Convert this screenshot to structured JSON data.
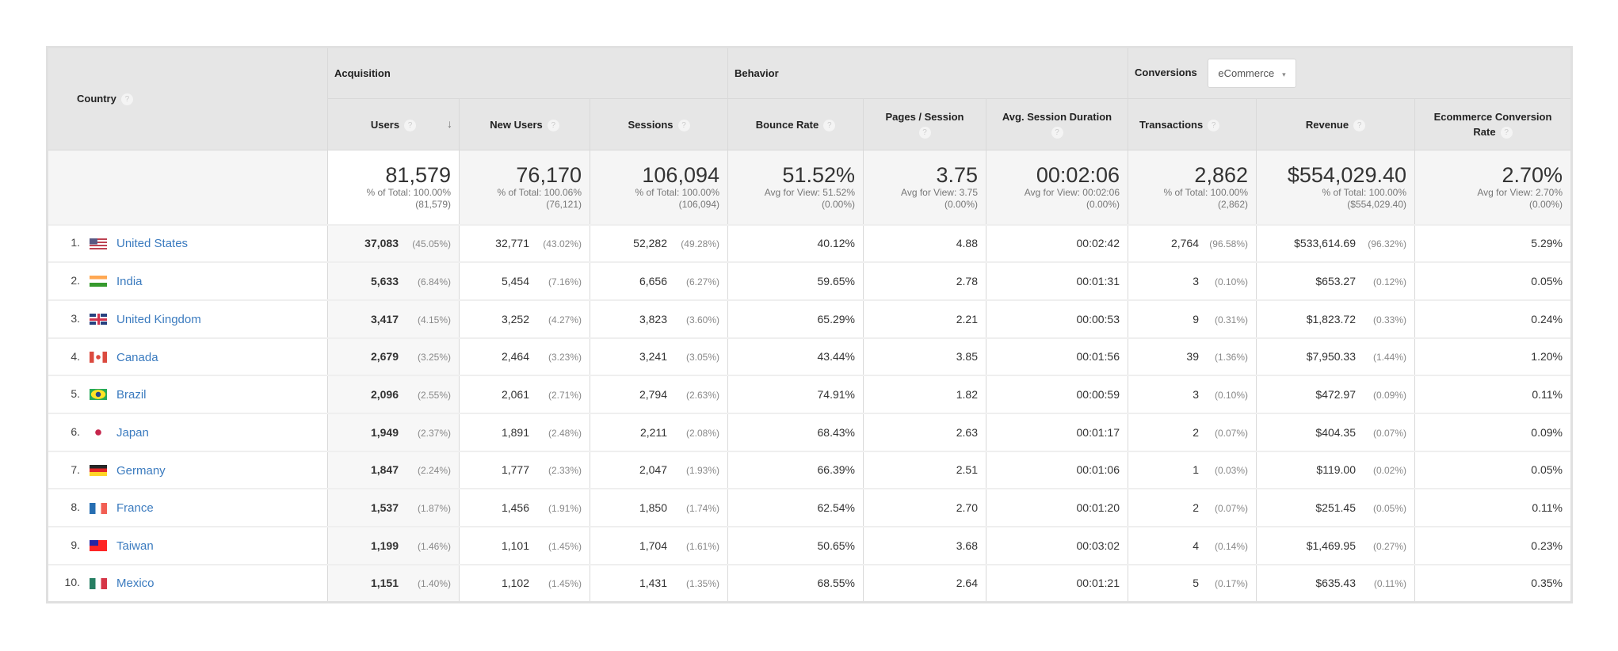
{
  "groups": {
    "acquisition": "Acquisition",
    "behavior": "Behavior",
    "conversions": "Conversions",
    "conversions_select": "eCommerce"
  },
  "columns": {
    "country": "Country",
    "users": "Users",
    "new_users": "New Users",
    "sessions": "Sessions",
    "bounce_rate": "Bounce Rate",
    "pages_session": "Pages / Session",
    "avg_duration": "Avg. Session Duration",
    "transactions": "Transactions",
    "revenue": "Revenue",
    "ecr_line1": "Ecommerce Conversion",
    "ecr_line2": "Rate"
  },
  "icons": {
    "help": "?",
    "sort": "↓",
    "caret": "▾"
  },
  "totals": {
    "users": {
      "value": "81,579",
      "line1": "% of Total: 100.00%",
      "line2": "(81,579)"
    },
    "new_users": {
      "value": "76,170",
      "line1": "% of Total: 100.06%",
      "line2": "(76,121)"
    },
    "sessions": {
      "value": "106,094",
      "line1": "% of Total: 100.00%",
      "line2": "(106,094)"
    },
    "bounce_rate": {
      "value": "51.52%",
      "line1": "Avg for View: 51.52%",
      "line2": "(0.00%)"
    },
    "pages_session": {
      "value": "3.75",
      "line1": "Avg for View: 3.75",
      "line2": "(0.00%)"
    },
    "avg_duration": {
      "value": "00:02:06",
      "line1": "Avg for View: 00:02:06",
      "line2": "(0.00%)"
    },
    "transactions": {
      "value": "2,862",
      "line1": "% of Total: 100.00%",
      "line2": "(2,862)"
    },
    "revenue": {
      "value": "$554,029.40",
      "line1": "% of Total: 100.00%",
      "line2": "($554,029.40)"
    },
    "ecr": {
      "value": "2.70%",
      "line1": "Avg for View: 2.70%",
      "line2": "(0.00%)"
    }
  },
  "rows": [
    {
      "rank": "1.",
      "country": "United States",
      "flag": "us",
      "users": "37,083",
      "users_pct": "(45.05%)",
      "new_users": "32,771",
      "new_users_pct": "(43.02%)",
      "sessions": "52,282",
      "sessions_pct": "(49.28%)",
      "bounce_rate": "40.12%",
      "pages_session": "4.88",
      "avg_duration": "00:02:42",
      "transactions": "2,764",
      "transactions_pct": "(96.58%)",
      "revenue": "$533,614.69",
      "revenue_pct": "(96.32%)",
      "ecr": "5.29%"
    },
    {
      "rank": "2.",
      "country": "India",
      "flag": "in",
      "users": "5,633",
      "users_pct": "(6.84%)",
      "new_users": "5,454",
      "new_users_pct": "(7.16%)",
      "sessions": "6,656",
      "sessions_pct": "(6.27%)",
      "bounce_rate": "59.65%",
      "pages_session": "2.78",
      "avg_duration": "00:01:31",
      "transactions": "3",
      "transactions_pct": "(0.10%)",
      "revenue": "$653.27",
      "revenue_pct": "(0.12%)",
      "ecr": "0.05%"
    },
    {
      "rank": "3.",
      "country": "United Kingdom",
      "flag": "gb",
      "users": "3,417",
      "users_pct": "(4.15%)",
      "new_users": "3,252",
      "new_users_pct": "(4.27%)",
      "sessions": "3,823",
      "sessions_pct": "(3.60%)",
      "bounce_rate": "65.29%",
      "pages_session": "2.21",
      "avg_duration": "00:00:53",
      "transactions": "9",
      "transactions_pct": "(0.31%)",
      "revenue": "$1,823.72",
      "revenue_pct": "(0.33%)",
      "ecr": "0.24%"
    },
    {
      "rank": "4.",
      "country": "Canada",
      "flag": "ca",
      "users": "2,679",
      "users_pct": "(3.25%)",
      "new_users": "2,464",
      "new_users_pct": "(3.23%)",
      "sessions": "3,241",
      "sessions_pct": "(3.05%)",
      "bounce_rate": "43.44%",
      "pages_session": "3.85",
      "avg_duration": "00:01:56",
      "transactions": "39",
      "transactions_pct": "(1.36%)",
      "revenue": "$7,950.33",
      "revenue_pct": "(1.44%)",
      "ecr": "1.20%"
    },
    {
      "rank": "5.",
      "country": "Brazil",
      "flag": "br",
      "users": "2,096",
      "users_pct": "(2.55%)",
      "new_users": "2,061",
      "new_users_pct": "(2.71%)",
      "sessions": "2,794",
      "sessions_pct": "(2.63%)",
      "bounce_rate": "74.91%",
      "pages_session": "1.82",
      "avg_duration": "00:00:59",
      "transactions": "3",
      "transactions_pct": "(0.10%)",
      "revenue": "$472.97",
      "revenue_pct": "(0.09%)",
      "ecr": "0.11%"
    },
    {
      "rank": "6.",
      "country": "Japan",
      "flag": "jp",
      "users": "1,949",
      "users_pct": "(2.37%)",
      "new_users": "1,891",
      "new_users_pct": "(2.48%)",
      "sessions": "2,211",
      "sessions_pct": "(2.08%)",
      "bounce_rate": "68.43%",
      "pages_session": "2.63",
      "avg_duration": "00:01:17",
      "transactions": "2",
      "transactions_pct": "(0.07%)",
      "revenue": "$404.35",
      "revenue_pct": "(0.07%)",
      "ecr": "0.09%"
    },
    {
      "rank": "7.",
      "country": "Germany",
      "flag": "de",
      "users": "1,847",
      "users_pct": "(2.24%)",
      "new_users": "1,777",
      "new_users_pct": "(2.33%)",
      "sessions": "2,047",
      "sessions_pct": "(1.93%)",
      "bounce_rate": "66.39%",
      "pages_session": "2.51",
      "avg_duration": "00:01:06",
      "transactions": "1",
      "transactions_pct": "(0.03%)",
      "revenue": "$119.00",
      "revenue_pct": "(0.02%)",
      "ecr": "0.05%"
    },
    {
      "rank": "8.",
      "country": "France",
      "flag": "fr",
      "users": "1,537",
      "users_pct": "(1.87%)",
      "new_users": "1,456",
      "new_users_pct": "(1.91%)",
      "sessions": "1,850",
      "sessions_pct": "(1.74%)",
      "bounce_rate": "62.54%",
      "pages_session": "2.70",
      "avg_duration": "00:01:20",
      "transactions": "2",
      "transactions_pct": "(0.07%)",
      "revenue": "$251.45",
      "revenue_pct": "(0.05%)",
      "ecr": "0.11%"
    },
    {
      "rank": "9.",
      "country": "Taiwan",
      "flag": "tw",
      "users": "1,199",
      "users_pct": "(1.46%)",
      "new_users": "1,101",
      "new_users_pct": "(1.45%)",
      "sessions": "1,704",
      "sessions_pct": "(1.61%)",
      "bounce_rate": "50.65%",
      "pages_session": "3.68",
      "avg_duration": "00:03:02",
      "transactions": "4",
      "transactions_pct": "(0.14%)",
      "revenue": "$1,469.95",
      "revenue_pct": "(0.27%)",
      "ecr": "0.23%"
    },
    {
      "rank": "10.",
      "country": "Mexico",
      "flag": "mx",
      "users": "1,151",
      "users_pct": "(1.40%)",
      "new_users": "1,102",
      "new_users_pct": "(1.45%)",
      "sessions": "1,431",
      "sessions_pct": "(1.35%)",
      "bounce_rate": "68.55%",
      "pages_session": "2.64",
      "avg_duration": "00:01:21",
      "transactions": "5",
      "transactions_pct": "(0.17%)",
      "revenue": "$635.43",
      "revenue_pct": "(0.11%)",
      "ecr": "0.35%"
    }
  ],
  "flag_colors": {
    "us": [
      "#b22234",
      "#ffffff",
      "#3c3b6e"
    ],
    "in": [
      "#ff9933",
      "#ffffff",
      "#138808"
    ],
    "gb": [
      "#012169",
      "#ffffff",
      "#c8102e"
    ],
    "ca": [
      "#d52b1e",
      "#ffffff"
    ],
    "br": [
      "#009c3b",
      "#ffdf00",
      "#002776"
    ],
    "jp": [
      "#ffffff",
      "#bc002d"
    ],
    "de": [
      "#000000",
      "#dd0000",
      "#ffce00"
    ],
    "fr": [
      "#0055a4",
      "#ffffff",
      "#ef4135"
    ],
    "tw": [
      "#fe0000",
      "#000095",
      "#ffffff"
    ],
    "mx": [
      "#006847",
      "#ffffff",
      "#ce1126"
    ]
  },
  "colors": {
    "link": "#3b7bbf",
    "header_bg": "#e6e6e6",
    "totals_bg": "#f5f5f5"
  }
}
